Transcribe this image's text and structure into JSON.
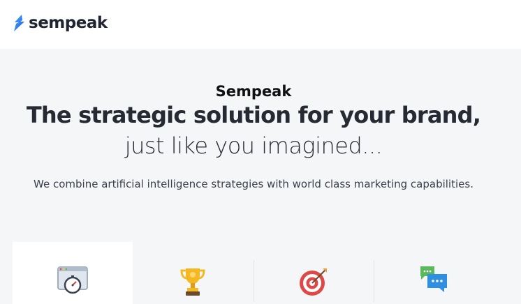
{
  "header": {
    "logo_text": "sempeak",
    "brand_color": "#3a7bf0"
  },
  "hero": {
    "brand": "Sempeak",
    "headline": "The strategic solution for your brand,",
    "subline": "just like you imagined...",
    "description": "We combine artificial intelligence strategies with world class marketing capabilities."
  },
  "features": [
    {
      "icon": "stopwatch-icon",
      "active": true
    },
    {
      "icon": "trophy-icon",
      "active": false
    },
    {
      "icon": "target-icon",
      "active": false
    },
    {
      "icon": "chat-icon",
      "active": false
    }
  ]
}
